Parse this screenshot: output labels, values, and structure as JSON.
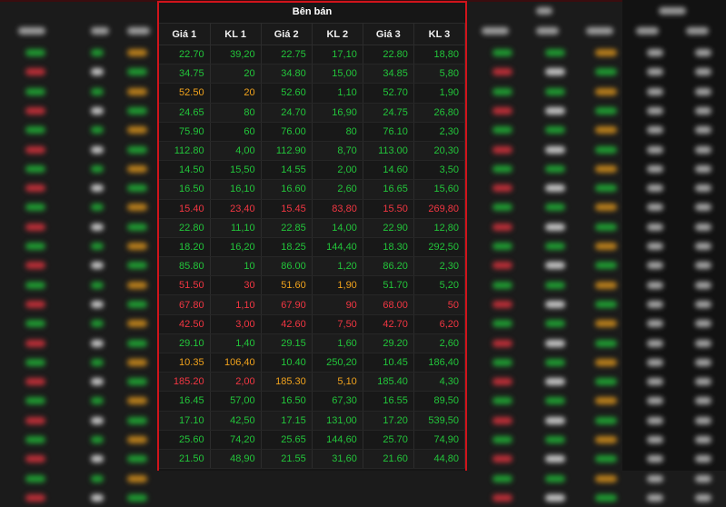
{
  "panel": {
    "title": "Bên bán",
    "headers": [
      "Giá 1",
      "KL 1",
      "Giá 2",
      "KL 2",
      "Giá 3",
      "KL 3"
    ]
  },
  "rows": [
    [
      [
        "22.70",
        "g"
      ],
      [
        "39,20",
        "g"
      ],
      [
        "22.75",
        "g"
      ],
      [
        "17,10",
        "g"
      ],
      [
        "22.80",
        "g"
      ],
      [
        "18,80",
        "g"
      ]
    ],
    [
      [
        "34.75",
        "g"
      ],
      [
        "20",
        "g"
      ],
      [
        "34.80",
        "g"
      ],
      [
        "15,00",
        "g"
      ],
      [
        "34.85",
        "g"
      ],
      [
        "5,80",
        "g"
      ]
    ],
    [
      [
        "52.50",
        "y"
      ],
      [
        "20",
        "y"
      ],
      [
        "52.60",
        "g"
      ],
      [
        "1,10",
        "g"
      ],
      [
        "52.70",
        "g"
      ],
      [
        "1,90",
        "g"
      ]
    ],
    [
      [
        "24.65",
        "g"
      ],
      [
        "80",
        "g"
      ],
      [
        "24.70",
        "g"
      ],
      [
        "16,90",
        "g"
      ],
      [
        "24.75",
        "g"
      ],
      [
        "26,80",
        "g"
      ]
    ],
    [
      [
        "75.90",
        "g"
      ],
      [
        "60",
        "g"
      ],
      [
        "76.00",
        "g"
      ],
      [
        "80",
        "g"
      ],
      [
        "76.10",
        "g"
      ],
      [
        "2,30",
        "g"
      ]
    ],
    [
      [
        "112.80",
        "g"
      ],
      [
        "4,00",
        "g"
      ],
      [
        "112.90",
        "g"
      ],
      [
        "8,70",
        "g"
      ],
      [
        "113.00",
        "g"
      ],
      [
        "20,30",
        "g"
      ]
    ],
    [
      [
        "14.50",
        "g"
      ],
      [
        "15,50",
        "g"
      ],
      [
        "14.55",
        "g"
      ],
      [
        "2,00",
        "g"
      ],
      [
        "14.60",
        "g"
      ],
      [
        "3,50",
        "g"
      ]
    ],
    [
      [
        "16.50",
        "g"
      ],
      [
        "16,10",
        "g"
      ],
      [
        "16.60",
        "g"
      ],
      [
        "2,60",
        "g"
      ],
      [
        "16.65",
        "g"
      ],
      [
        "15,60",
        "g"
      ]
    ],
    [
      [
        "15.40",
        "r"
      ],
      [
        "23,40",
        "r"
      ],
      [
        "15.45",
        "r"
      ],
      [
        "83,80",
        "r"
      ],
      [
        "15.50",
        "r"
      ],
      [
        "269,80",
        "r"
      ]
    ],
    [
      [
        "22.80",
        "g"
      ],
      [
        "11,10",
        "g"
      ],
      [
        "22.85",
        "g"
      ],
      [
        "14,00",
        "g"
      ],
      [
        "22.90",
        "g"
      ],
      [
        "12,80",
        "g"
      ]
    ],
    [
      [
        "18.20",
        "g"
      ],
      [
        "16,20",
        "g"
      ],
      [
        "18.25",
        "g"
      ],
      [
        "144,40",
        "g"
      ],
      [
        "18.30",
        "g"
      ],
      [
        "292,50",
        "g"
      ]
    ],
    [
      [
        "85.80",
        "g"
      ],
      [
        "10",
        "g"
      ],
      [
        "86.00",
        "g"
      ],
      [
        "1,20",
        "g"
      ],
      [
        "86.20",
        "g"
      ],
      [
        "2,30",
        "g"
      ]
    ],
    [
      [
        "51.50",
        "r"
      ],
      [
        "30",
        "r"
      ],
      [
        "51.60",
        "y"
      ],
      [
        "1,90",
        "y"
      ],
      [
        "51.70",
        "g"
      ],
      [
        "5,20",
        "g"
      ]
    ],
    [
      [
        "67.80",
        "r"
      ],
      [
        "1,10",
        "r"
      ],
      [
        "67.90",
        "r"
      ],
      [
        "90",
        "r"
      ],
      [
        "68.00",
        "r"
      ],
      [
        "50",
        "r"
      ]
    ],
    [
      [
        "42.50",
        "r"
      ],
      [
        "3,00",
        "r"
      ],
      [
        "42.60",
        "r"
      ],
      [
        "7,50",
        "r"
      ],
      [
        "42.70",
        "r"
      ],
      [
        "6,20",
        "r"
      ]
    ],
    [
      [
        "29.10",
        "g"
      ],
      [
        "1,40",
        "g"
      ],
      [
        "29.15",
        "g"
      ],
      [
        "1,60",
        "g"
      ],
      [
        "29.20",
        "g"
      ],
      [
        "2,60",
        "g"
      ]
    ],
    [
      [
        "10.35",
        "y"
      ],
      [
        "106,40",
        "y"
      ],
      [
        "10.40",
        "g"
      ],
      [
        "250,20",
        "g"
      ],
      [
        "10.45",
        "g"
      ],
      [
        "186,40",
        "g"
      ]
    ],
    [
      [
        "185.20",
        "r"
      ],
      [
        "2,00",
        "r"
      ],
      [
        "185.30",
        "y"
      ],
      [
        "5,10",
        "y"
      ],
      [
        "185.40",
        "g"
      ],
      [
        "4,30",
        "g"
      ]
    ],
    [
      [
        "16.45",
        "g"
      ],
      [
        "57,00",
        "g"
      ],
      [
        "16.50",
        "g"
      ],
      [
        "67,30",
        "g"
      ],
      [
        "16.55",
        "g"
      ],
      [
        "89,50",
        "g"
      ]
    ],
    [
      [
        "17.10",
        "g"
      ],
      [
        "42,50",
        "g"
      ],
      [
        "17.15",
        "g"
      ],
      [
        "131,00",
        "g"
      ],
      [
        "17.20",
        "g"
      ],
      [
        "539,50",
        "g"
      ]
    ],
    [
      [
        "25.60",
        "g"
      ],
      [
        "74,20",
        "g"
      ],
      [
        "25.65",
        "g"
      ],
      [
        "144,60",
        "g"
      ],
      [
        "25.70",
        "g"
      ],
      [
        "74,90",
        "g"
      ]
    ],
    [
      [
        "21.50",
        "g"
      ],
      [
        "48,90",
        "g"
      ],
      [
        "21.55",
        "g"
      ],
      [
        "31,60",
        "g"
      ],
      [
        "21.60",
        "g"
      ],
      [
        "44,80",
        "g"
      ]
    ]
  ],
  "colors": {
    "green": "#22c53a",
    "red": "#f23642",
    "yellow": "#f0a21c",
    "border": "#d0141b"
  }
}
